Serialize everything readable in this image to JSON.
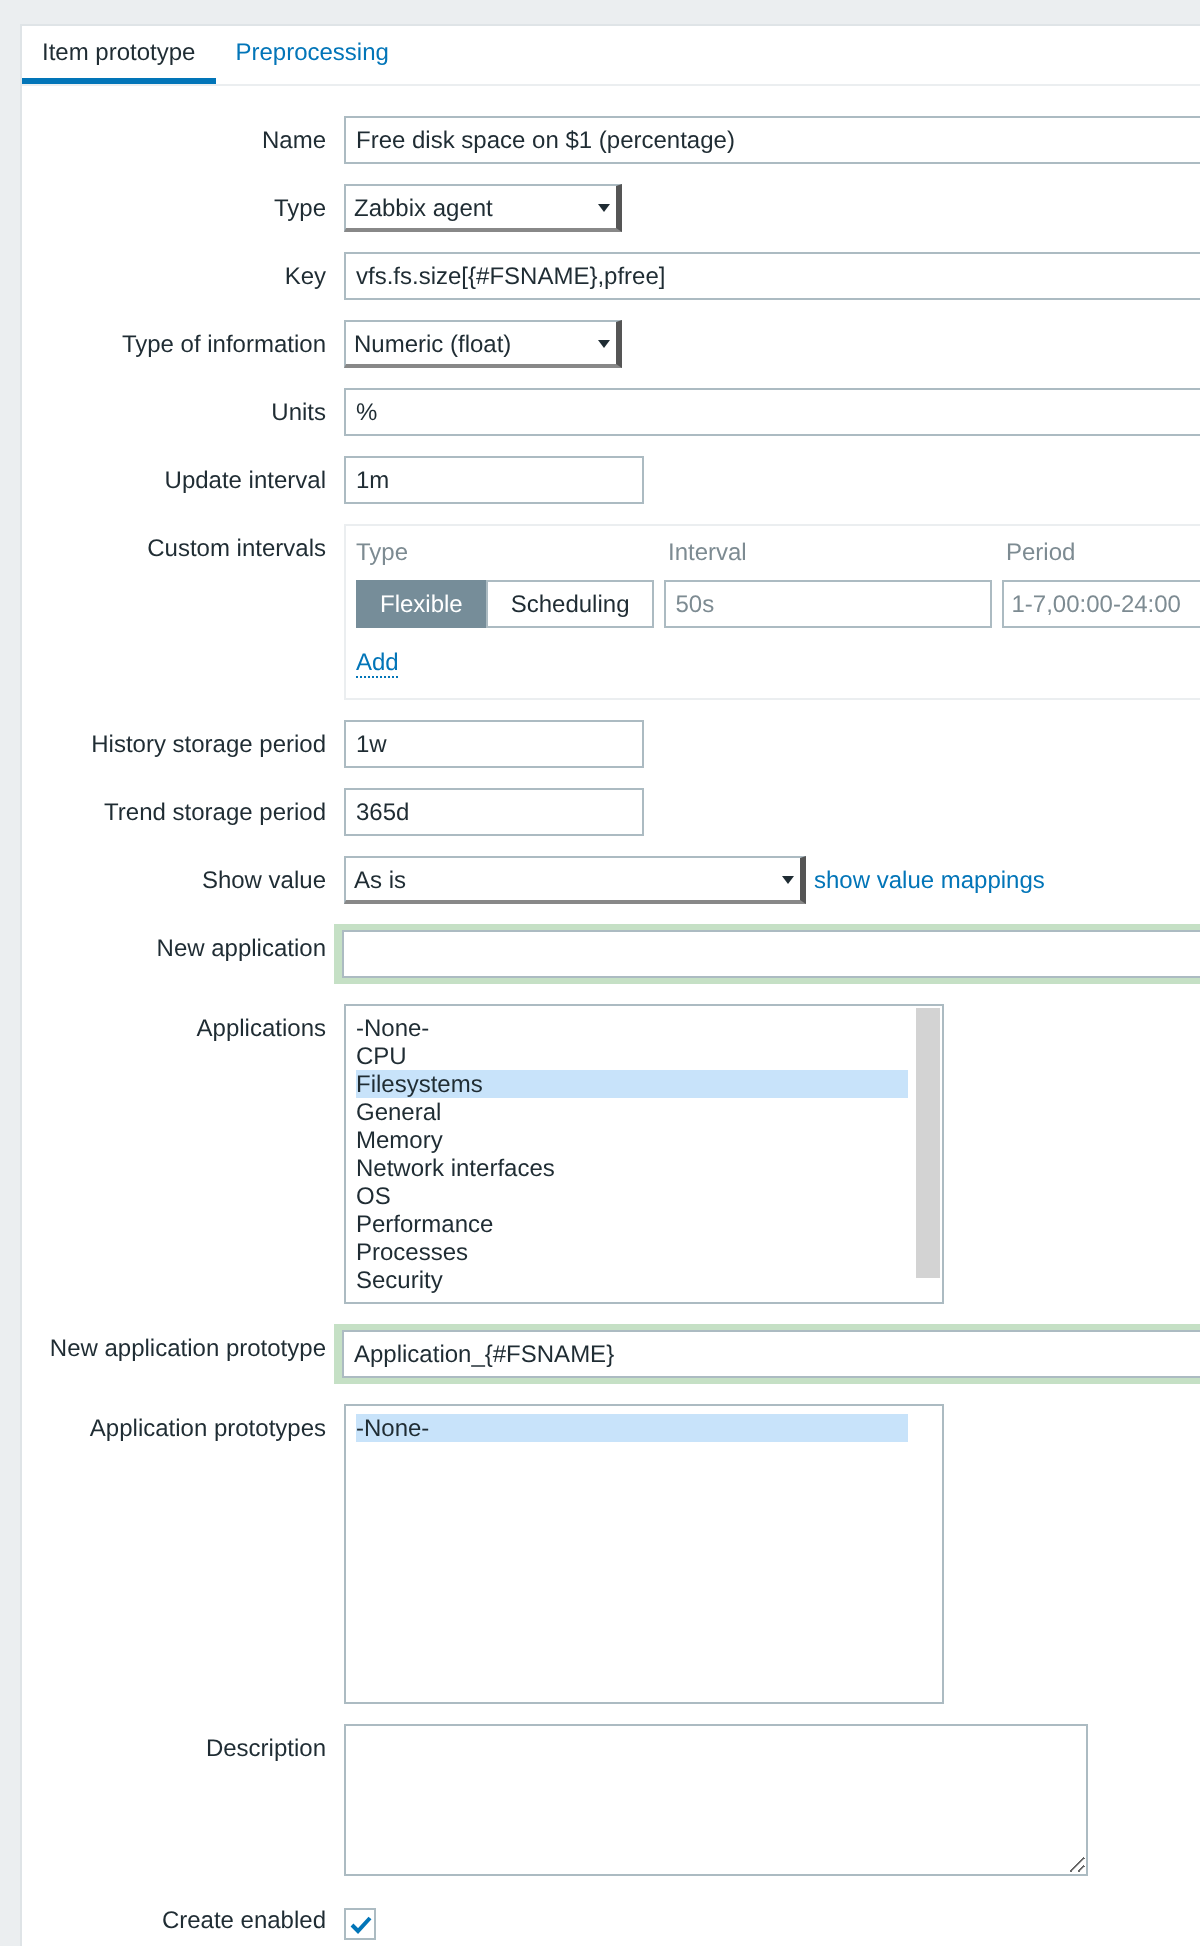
{
  "tabs": [
    {
      "label": "Item prototype",
      "selected": true
    },
    {
      "label": "Preprocessing",
      "selected": false
    }
  ],
  "fields": [
    {
      "kind": "text",
      "label": "Name",
      "value": "Free disk space on $1 (percentage)"
    },
    {
      "kind": "select",
      "label": "Type",
      "value": "Zabbix agent"
    },
    {
      "kind": "text",
      "label": "Key",
      "value": "vfs.fs.size[{#FSNAME},pfree]"
    },
    {
      "kind": "select",
      "label": "Type of information",
      "value": "Numeric (float)"
    },
    {
      "kind": "text",
      "label": "Units",
      "value": "%"
    },
    {
      "kind": "short",
      "label": "Update interval",
      "value": "1m"
    },
    {
      "kind": "intervals",
      "label": "Custom intervals",
      "columns": [
        "Type",
        "Interval",
        "Period"
      ],
      "modes": [
        {
          "label": "Flexible",
          "selected": true
        },
        {
          "label": "Scheduling",
          "selected": false
        }
      ],
      "interval_placeholder": "50s",
      "period_placeholder": "1-7,00:00-24:00",
      "add_link": "Add"
    },
    {
      "kind": "short",
      "label": "History storage period",
      "value": "1w"
    },
    {
      "kind": "short",
      "label": "Trend storage period",
      "value": "365d"
    },
    {
      "kind": "select",
      "label": "Show value",
      "value": "As is",
      "link": "show value mappings"
    },
    {
      "kind": "new",
      "label": "New application"
    },
    {
      "kind": "list",
      "label": "Applications",
      "options": [
        {
          "label": "-None-",
          "selected": false
        },
        {
          "label": "CPU",
          "selected": false
        },
        {
          "label": "Filesystems",
          "selected": true
        },
        {
          "label": "General",
          "selected": false
        },
        {
          "label": "Memory",
          "selected": false
        },
        {
          "label": "Network interfaces",
          "selected": false
        },
        {
          "label": "OS",
          "selected": false
        },
        {
          "label": "Performance",
          "selected": false
        },
        {
          "label": "Processes",
          "selected": false
        },
        {
          "label": "Security",
          "selected": false
        }
      ]
    },
    {
      "kind": "new",
      "label": "New application prototype",
      "value": "Application_{#FSNAME}"
    },
    {
      "kind": "list",
      "label": "Application prototypes",
      "options": [
        {
          "label": "-None-",
          "selected": true
        }
      ]
    },
    {
      "kind": "textarea",
      "label": "Description"
    },
    {
      "kind": "checkbox",
      "label": "Create enabled",
      "checked": true
    }
  ]
}
